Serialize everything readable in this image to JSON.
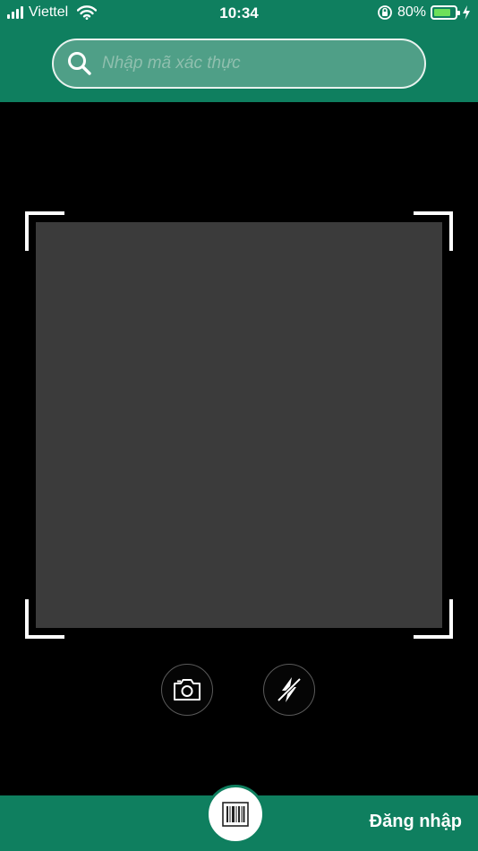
{
  "status_bar": {
    "carrier": "Viettel",
    "time": "10:34",
    "battery_percent_label": "80%",
    "battery_level": 0.8
  },
  "search": {
    "placeholder": "Nhập mã xác thực",
    "value": ""
  },
  "scanner": {
    "camera_icon": "camera-icon",
    "flash_icon": "flash-off-icon"
  },
  "bottom_bar": {
    "scan_icon": "barcode-icon",
    "login_label": "Đăng nhập"
  },
  "colors": {
    "brand_green": "#0f7f5f",
    "viewfinder_gray": "#3b3b3b",
    "battery_green": "#6de05a"
  }
}
